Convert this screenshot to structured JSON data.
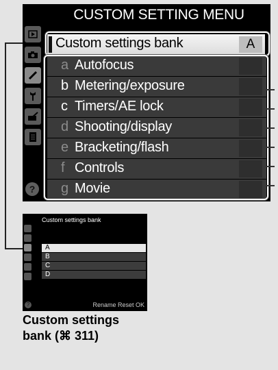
{
  "main_screen": {
    "title": "CUSTOM SETTING MENU",
    "side_tabs": [
      "playback-icon",
      "camera-icon",
      "pencil-icon",
      "wrench-icon",
      "retouch-icon",
      "my-menu-icon"
    ],
    "help": "?",
    "bank": {
      "label": "Custom settings bank",
      "value": "A"
    },
    "items": [
      {
        "letter": "a",
        "label": "Autofocus"
      },
      {
        "letter": "b",
        "label": "Metering/exposure"
      },
      {
        "letter": "c",
        "label": "Timers/AE lock"
      },
      {
        "letter": "d",
        "label": "Shooting/display"
      },
      {
        "letter": "e",
        "label": "Bracketing/flash"
      },
      {
        "letter": "f",
        "label": "Controls"
      },
      {
        "letter": "g",
        "label": "Movie"
      }
    ]
  },
  "sub_screen": {
    "title": "Custom settings bank",
    "options": [
      "A",
      "B",
      "C",
      "D"
    ],
    "selected": "A",
    "help": "?",
    "footer": "Rename  Reset OK"
  },
  "caption": {
    "line1": "Custom settings",
    "line2": "bank (⌘ 311)"
  },
  "colors": {
    "screen_bg": "#000000",
    "highlight": "#e8e8e8",
    "item_bg": "#3a3a3a",
    "page_bg": "#e4e4e4"
  }
}
